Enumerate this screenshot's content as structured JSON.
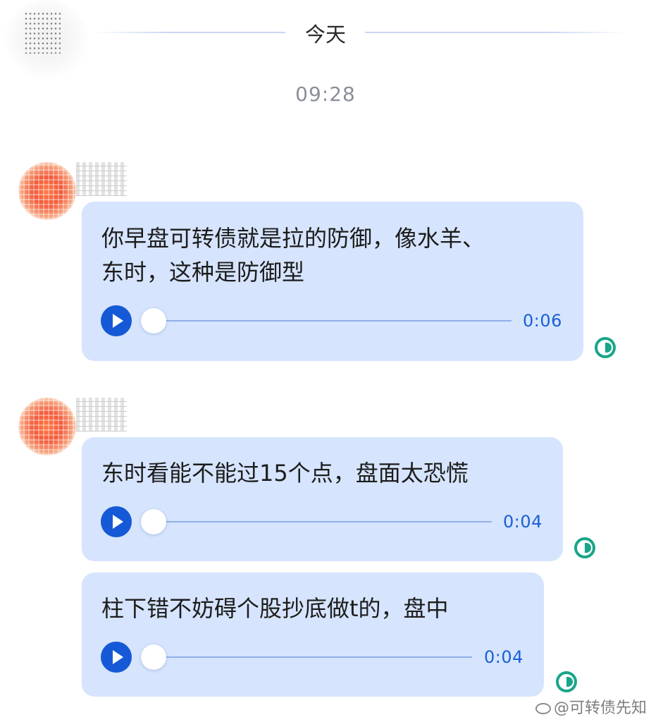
{
  "header": {
    "day_label": "今天",
    "time": "09:28"
  },
  "messages": [
    {
      "lines": [
        "你早盘可转债就是拉的防御，像水羊、",
        "东时，这种是防御型"
      ],
      "duration": "0:06"
    },
    {
      "lines": [
        "东时看能不能过15个点，盘面太恐慌"
      ],
      "duration": "0:04"
    },
    {
      "lines": [
        "柱下错不妨碍个股抄底做t的，盘中"
      ],
      "duration": "0:04"
    }
  ],
  "watermark": {
    "text": "@可转债先知"
  },
  "colors": {
    "bubble": "#d6e4fd",
    "accent": "#1559d6",
    "read_receipt": "#1aa58a"
  },
  "icons": {
    "play": "play-icon",
    "read_receipt": "read-receipt-icon",
    "watermark": "weibo-icon"
  }
}
